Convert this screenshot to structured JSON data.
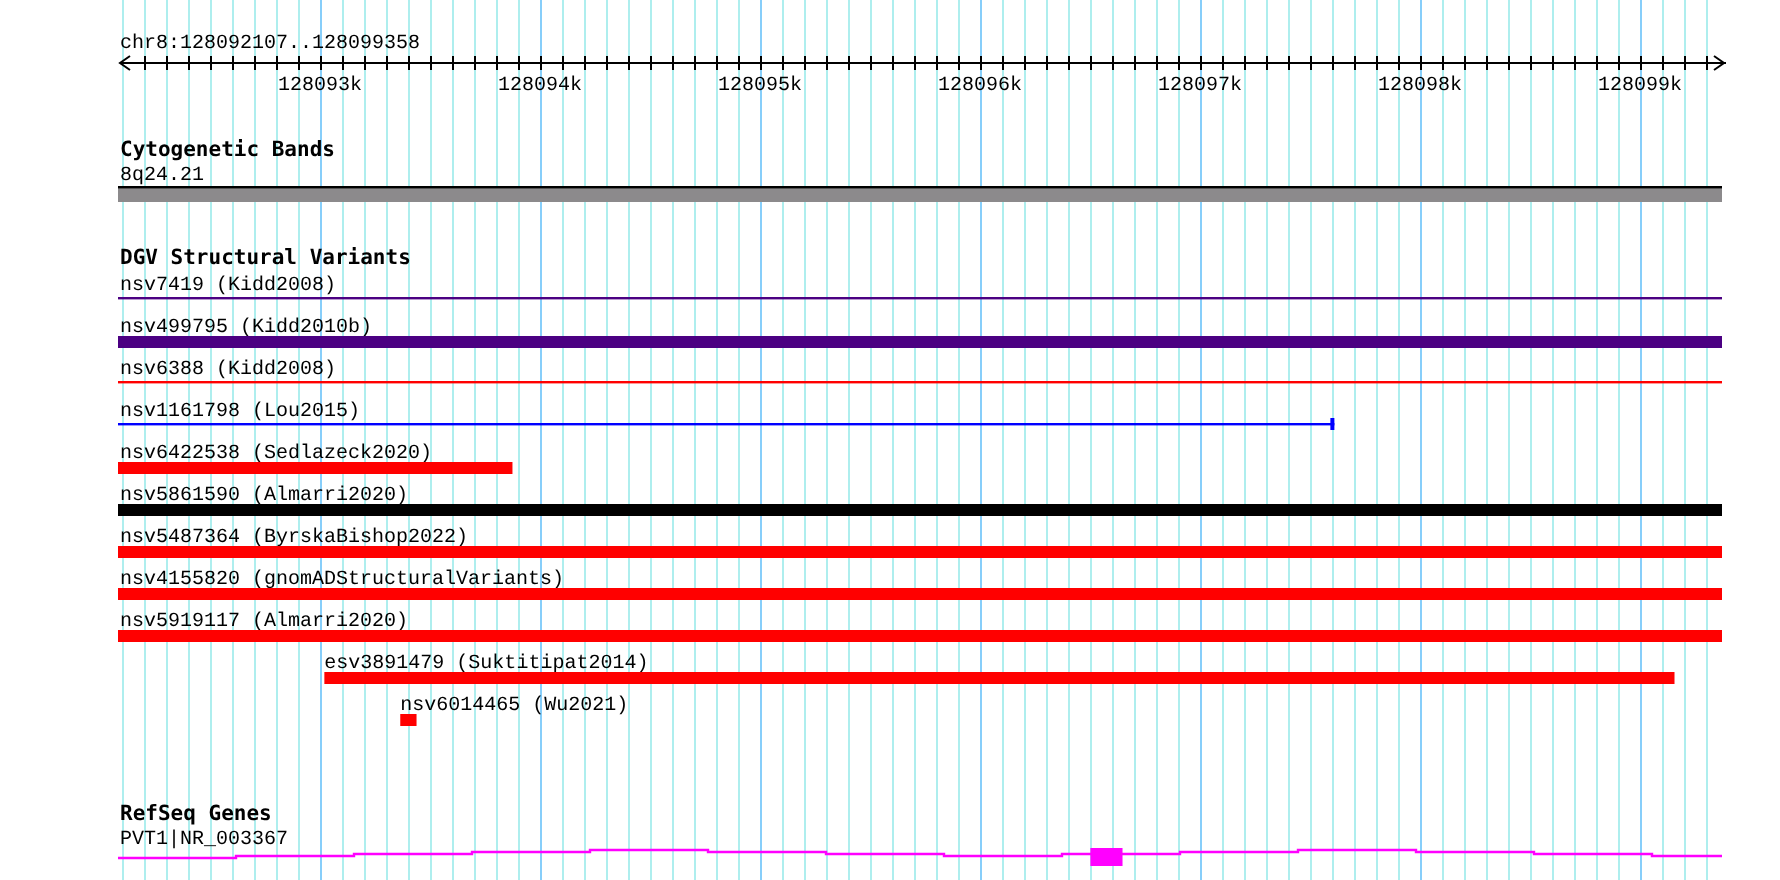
{
  "ruler": {
    "label": "chr8:128092107..128099358",
    "ticks": [
      "128093k",
      "128094k",
      "128095k",
      "128096k",
      "128097k",
      "128098k",
      "128099k"
    ]
  },
  "cytoband": {
    "title": "Cytogenetic Bands",
    "band": "8q24.21"
  },
  "variants": {
    "title": "DGV Structural Variants",
    "items": [
      {
        "label": "nsv7419 (Kidd2008)",
        "kind": "thin",
        "color": "#4b0082"
      },
      {
        "label": "nsv499795 (Kidd2010b)",
        "kind": "thick",
        "color": "#4b0082"
      },
      {
        "label": "nsv6388 (Kidd2008)",
        "kind": "thin",
        "color": "#ff0000"
      },
      {
        "label": "nsv1161798 (Lou2015)",
        "kind": "thin",
        "color": "#0000ff"
      },
      {
        "label": "nsv6422538 (Sedlazeck2020)",
        "kind": "thick",
        "color": "#ff0000"
      },
      {
        "label": "nsv5861590 (Almarri2020)",
        "kind": "thick",
        "color": "#000000"
      },
      {
        "label": "nsv5487364 (ByrskaBishop2022)",
        "kind": "thick",
        "color": "#ff0000"
      },
      {
        "label": "nsv4155820 (gnomADStructuralVariants)",
        "kind": "thick",
        "color": "#ff0000"
      },
      {
        "label": "nsv5919117 (Almarri2020)",
        "kind": "thick",
        "color": "#ff0000"
      },
      {
        "label": "esv3891479 (Suktitipat2014)",
        "kind": "thick",
        "color": "#ff0000"
      },
      {
        "label": "nsv6014465 (Wu2021)",
        "kind": "thick",
        "color": "#ff0000"
      }
    ]
  },
  "genes": {
    "title": "RefSeq Genes",
    "items": [
      {
        "label": "PVT1|NR_003367"
      }
    ]
  }
}
